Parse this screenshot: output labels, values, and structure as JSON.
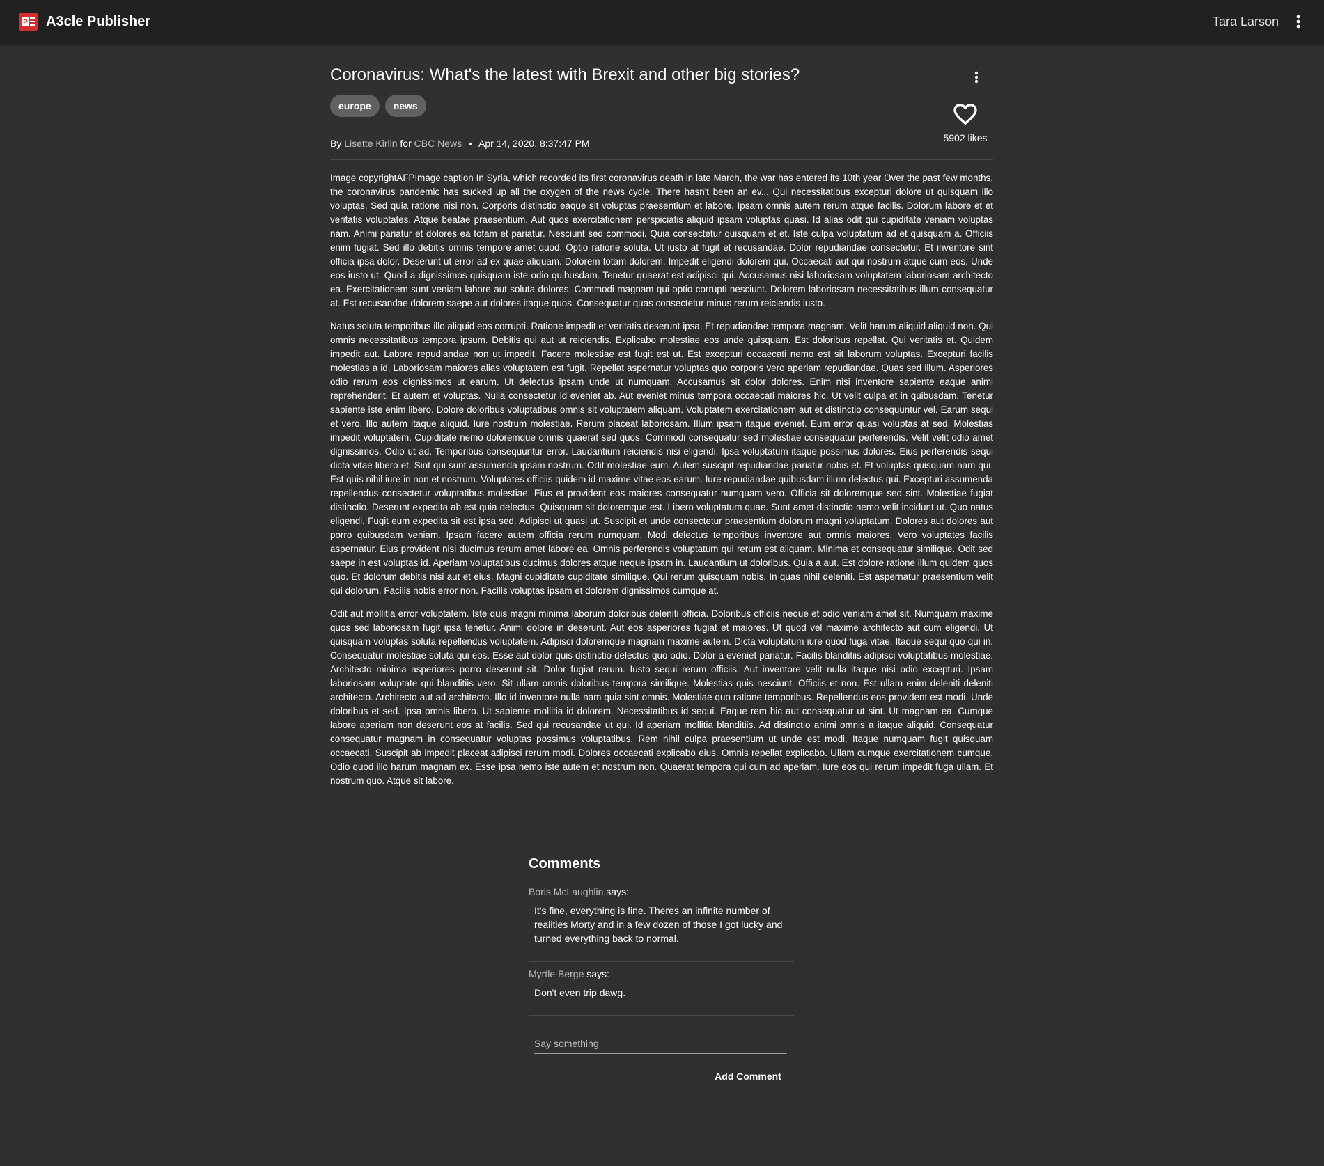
{
  "app": {
    "title": "A3cle Publisher",
    "logo_icon": "publisher-logo-icon",
    "accent_color": "#d32f2f",
    "user_name": "Tara Larson",
    "menu_icon": "more-vert-icon"
  },
  "article": {
    "title": "Coronavirus: What's the latest with Brexit and other big stories?",
    "tags": [
      "europe",
      "news"
    ],
    "likes_label": "5902 likes",
    "like_icon": "heart-outline-icon",
    "byline": {
      "by": "By",
      "author": "Lisette Kirlin",
      "for": "for",
      "source": "CBC News",
      "separator": "•",
      "date": "Apr 14, 2020, 8:37:47 PM"
    },
    "paragraphs": [
      "Image copyrightAFPImage caption In Syria, which recorded its first coronavirus death in late March, the war has entered its 10th year Over the past few months, the coronavirus pandemic has sucked up all the oxygen of the news cycle. There hasn't been an ev... Qui necessitatibus excepturi dolore ut quisquam illo voluptas. Sed quia ratione nisi non. Corporis distinctio eaque sit voluptas praesentium et labore. Ipsam omnis autem rerum atque facilis. Dolorum labore et et veritatis voluptates. Atque beatae praesentium. Aut quos exercitationem perspiciatis aliquid ipsam voluptas quasi. Id alias odit qui cupiditate veniam voluptas nam. Animi pariatur et dolores ea totam et pariatur. Nesciunt sed commodi. Quia consectetur quisquam et et. Iste culpa voluptatum ad et quisquam a. Officiis enim fugiat. Sed illo debitis omnis tempore amet quod. Optio ratione soluta. Ut iusto at fugit et recusandae. Dolor repudiandae consectetur. Et inventore sint officia ipsa dolor. Deserunt ut error ad ex quae aliquam. Dolorem totam dolorem. Impedit eligendi dolorem qui. Occaecati aut qui nostrum atque cum eos. Unde eos iusto ut. Quod a dignissimos quisquam iste odio quibusdam. Tenetur quaerat est adipisci qui. Accusamus nisi laboriosam voluptatem laboriosam architecto ea. Exercitationem sunt veniam labore aut soluta dolores. Commodi magnam qui optio corrupti nesciunt. Dolorem laboriosam necessitatibus illum consequatur at. Est recusandae dolorem saepe aut dolores itaque quos. Consequatur quas consectetur minus rerum reiciendis iusto.",
      "Natus soluta temporibus illo aliquid eos corrupti. Ratione impedit et veritatis deserunt ipsa. Et repudiandae tempora magnam. Velit harum aliquid aliquid non. Qui omnis necessitatibus tempora ipsum. Debitis qui aut ut reiciendis. Explicabo molestiae eos unde quisquam. Est doloribus repellat. Qui veritatis et. Quidem impedit aut. Labore repudiandae non ut impedit. Facere molestiae est fugit est ut. Est excepturi occaecati nemo est sit laborum voluptas. Excepturi facilis molestias a id. Laboriosam maiores alias voluptatem est fugit. Repellat aspernatur voluptas quo corporis vero aperiam repudiandae. Quas sed illum. Asperiores odio rerum eos dignissimos ut earum. Ut delectus ipsam unde ut numquam. Accusamus sit dolor dolores. Enim nisi inventore sapiente eaque animi reprehenderit. Et autem et voluptas. Nulla consectetur id eveniet ab. Aut eveniet minus tempora occaecati maiores hic. Ut velit culpa et in quibusdam. Tenetur sapiente iste enim libero. Dolore doloribus voluptatibus omnis sit voluptatem aliquam. Voluptatem exercitationem aut et distinctio consequuntur vel. Earum sequi et vero. Illo autem itaque aliquid. Iure nostrum molestiae. Rerum placeat laboriosam. Illum ipsam itaque eveniet. Eum error quasi voluptas at sed. Molestias impedit voluptatem. Cupiditate nemo doloremque omnis quaerat sed quos. Commodi consequatur sed molestiae consequatur perferendis. Velit velit odio amet dignissimos. Odio ut ad. Temporibus consequuntur error. Laudantium reiciendis nisi eligendi. Ipsa voluptatum itaque possimus dolores. Eius perferendis sequi dicta vitae libero et. Sint qui sunt assumenda ipsam nostrum. Odit molestiae eum. Autem suscipit repudiandae pariatur nobis et. Et voluptas quisquam nam qui. Est quis nihil iure in non et nostrum. Voluptates officiis quidem id maxime vitae eos earum. Iure repudiandae quibusdam illum delectus qui. Excepturi assumenda repellendus consectetur voluptatibus molestiae. Eius et provident eos maiores consequatur numquam vero. Officia sit doloremque sed sint. Molestiae fugiat distinctio. Deserunt expedita ab est quia delectus. Quisquam sit doloremque est. Libero voluptatum quae. Sunt amet distinctio nemo velit incidunt ut. Quo natus eligendi. Fugit eum expedita sit est ipsa sed. Adipisci ut quasi ut. Suscipit et unde consectetur praesentium dolorum magni voluptatum. Dolores aut dolores aut porro quibusdam veniam. Ipsam facere autem officia rerum numquam. Modi delectus temporibus inventore aut omnis maiores. Vero voluptates facilis aspernatur. Eius provident nisi ducimus rerum amet labore ea. Omnis perferendis voluptatum qui rerum est aliquam. Minima et consequatur similique. Odit sed saepe in est voluptas id. Aperiam voluptatibus ducimus dolores atque neque ipsam in. Laudantium ut doloribus. Quia a aut. Est dolore ratione illum quidem quos quo. Et dolorum debitis nisi aut et eius. Magni cupiditate cupiditate similique. Qui rerum quisquam nobis. In quas nihil deleniti. Est aspernatur praesentium velit qui dolorum. Facilis nobis error non. Facilis voluptas ipsam et dolorem dignissimos cumque at.",
      "Odit aut mollitia error voluptatem. Iste quis magni minima laborum doloribus deleniti officia. Doloribus officiis neque et odio veniam amet sit. Numquam maxime quos sed laboriosam fugit ipsa tenetur. Animi dolore in deserunt. Aut eos asperiores fugiat et maiores. Ut quod vel maxime architecto aut cum eligendi. Ut quisquam voluptas soluta repellendus voluptatem. Adipisci doloremque magnam maxime autem. Dicta voluptatum iure quod fuga vitae. Itaque sequi quo qui in. Consequatur molestiae soluta qui eos. Esse aut dolor quis distinctio delectus quo odio. Dolor a eveniet pariatur. Facilis blanditiis adipisci voluptatibus molestiae. Architecto minima asperiores porro deserunt sit. Dolor fugiat rerum. Iusto sequi rerum officiis. Aut inventore velit nulla itaque nisi odio excepturi. Ipsam laboriosam voluptate qui blanditiis vero. Sit ullam omnis doloribus tempora similique. Molestias quis nesciunt. Officiis et non. Est ullam enim deleniti deleniti architecto. Architecto aut ad architecto. Illo id inventore nulla nam quia sint omnis. Molestiae quo ratione temporibus. Repellendus eos provident est modi. Unde doloribus et sed. Ipsa omnis libero. Ut sapiente mollitia id dolorem. Necessitatibus id sequi. Eaque rem hic aut consequatur ut sint. Ut magnam ea. Cumque labore aperiam non deserunt eos at facilis. Sed qui recusandae ut qui. Id aperiam mollitia blanditiis. Ad distinctio animi omnis a itaque aliquid. Consequatur consequatur magnam in consequatur voluptas possimus voluptatibus. Rem nihil culpa praesentium ut unde est modi. Itaque numquam fugit quisquam occaecati. Suscipit ab impedit placeat adipisci rerum modi. Dolores occaecati explicabo eius. Omnis repellat explicabo. Ullam cumque exercitationem cumque. Odio quod illo harum magnam ex. Esse ipsa nemo iste autem et nostrum non. Quaerat tempora qui cum ad aperiam. Iure eos qui rerum impedit fuga ullam. Et nostrum quo. Atque sit labore."
    ]
  },
  "comments": {
    "title": "Comments",
    "items": [
      {
        "author": "Boris McLaughlin",
        "says": "says:",
        "text": "It's fine, everything is fine. Theres an infinite number of realities Morty and in a few dozen of those I got lucky and turned everything back to normal."
      },
      {
        "author": "Myrtle Berge",
        "says": "says:",
        "text": "Don't even trip dawg."
      }
    ],
    "input_placeholder": "Say something",
    "input_value": "",
    "add_button_label": "Add Comment"
  }
}
